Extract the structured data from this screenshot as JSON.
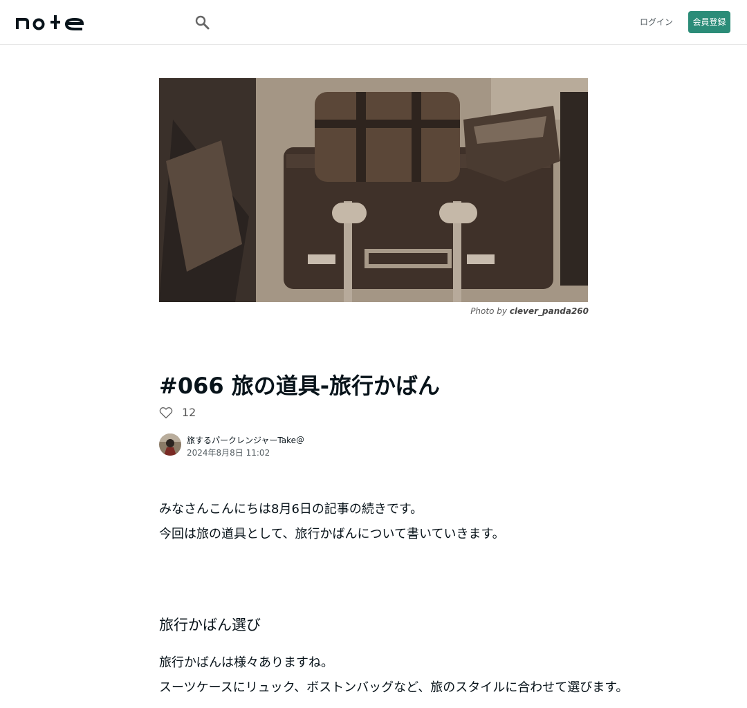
{
  "header": {
    "login_label": "ログイン",
    "signup_label": "会員登録",
    "accent_color": "#2b8c78"
  },
  "icons": {
    "logo": "note-logo",
    "search": "search-icon",
    "like": "heart-icon"
  },
  "hero": {
    "credit_prefix": "Photo by",
    "credit_author": "clever_panda260"
  },
  "article": {
    "title": "#066 旅の道具-旅行かばん",
    "likes": "12",
    "author": "旅するパークレンジャーTake＠",
    "date": "2024年8月8日 11:02",
    "paragraphs": [
      "みなさんこんにちは8月6日の記事の続きです。",
      "今回は旅の道具として、旅行かばんについて書いていきます。"
    ],
    "section_heading": "旅行かばん選び",
    "section_paragraphs": [
      "旅行かばんは様々ありますね。",
      "スーツケースにリュック、ボストンバッグなど、旅のスタイルに合わせて選びます。"
    ]
  }
}
